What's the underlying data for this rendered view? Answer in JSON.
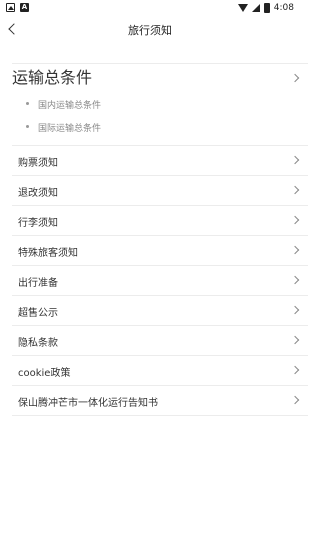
{
  "statusbar": {
    "time": "4:08",
    "icons": [
      "image-icon",
      "a-box-icon",
      "wifi-icon",
      "signal-icon",
      "battery-icon"
    ],
    "a_letter": "A"
  },
  "header": {
    "title": "旅行须知"
  },
  "sections": {
    "transport": {
      "label": "运输总条件",
      "items": [
        "国内运输总条件",
        "国际运输总条件"
      ]
    },
    "rows": [
      "购票须知",
      "退改须知",
      "行李须知",
      "特殊旅客须知",
      "出行准备",
      "超售公示",
      "隐私条款",
      "cookie政策",
      "保山腾冲芒市一体化运行告知书"
    ]
  }
}
